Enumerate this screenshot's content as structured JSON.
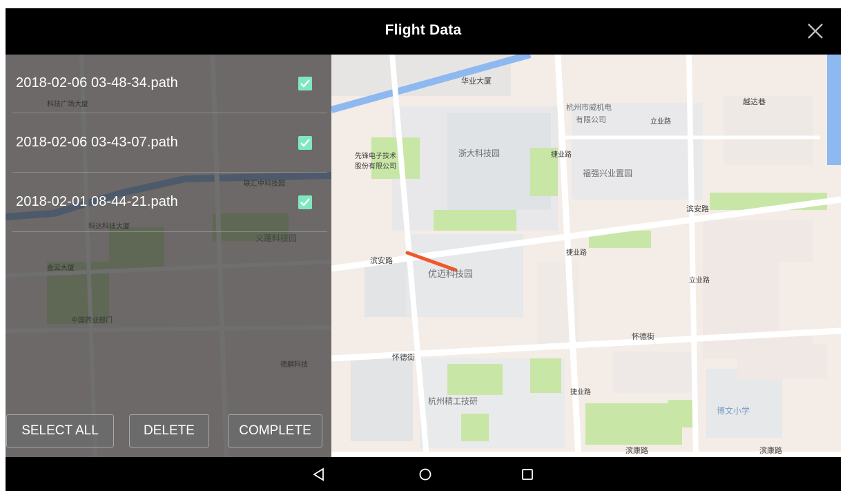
{
  "window": {
    "title": "Flight Data"
  },
  "files": [
    {
      "name": "2018-02-06 03-48-34.path",
      "checked": true
    },
    {
      "name": "2018-02-06 03-43-07.path",
      "checked": true
    },
    {
      "name": "2018-02-01 08-44-21.path",
      "checked": true
    }
  ],
  "actions": {
    "select_all": "SELECT ALL",
    "delete": "DELETE",
    "complete": "COMPLETE"
  },
  "map": {
    "labels": {
      "huaye": "华业大厦",
      "hangzhou_radio": "杭州市威机电",
      "hangzhou_radio2": "有限公司",
      "yuedage": "越达巷",
      "xianfeng": "先锋电子技术",
      "xianfeng2": "股份有限公司",
      "zheda_park": "浙大科技园",
      "fuqiang_park": "福强兴业置园",
      "jieye_rd": "捷业路",
      "bin_an_rd": "滨安路",
      "bin_an_rd2": "滨安路",
      "youmai_park": "优迈科技园",
      "jieye_rd2": "捷业路",
      "liye_rd": "立业路",
      "liye_rd2": "立业路",
      "huaide_st": "怀德街",
      "huaide_st2": "怀德街",
      "hzjt": "杭州精工技研",
      "jieye_rd3": "捷业路",
      "bowen": "博文小学",
      "binkang_rd": "滨康路",
      "binkang_rd2": "滨康路",
      "keji": "科技广场大厦",
      "keji2": "科达科技大厦",
      "jinyun": "金云大厦",
      "zhongguo": "中国药业部门",
      "dimu": "德麟科技",
      "dazhuang": "义蓬科技园",
      "lianhui": "联汇中科技园"
    },
    "accent_colors": {
      "route": "#f0582a",
      "water": "#8eb9f0",
      "park": "#c8e6a6",
      "road": "#ffffff",
      "land": "#f4ece6"
    }
  }
}
